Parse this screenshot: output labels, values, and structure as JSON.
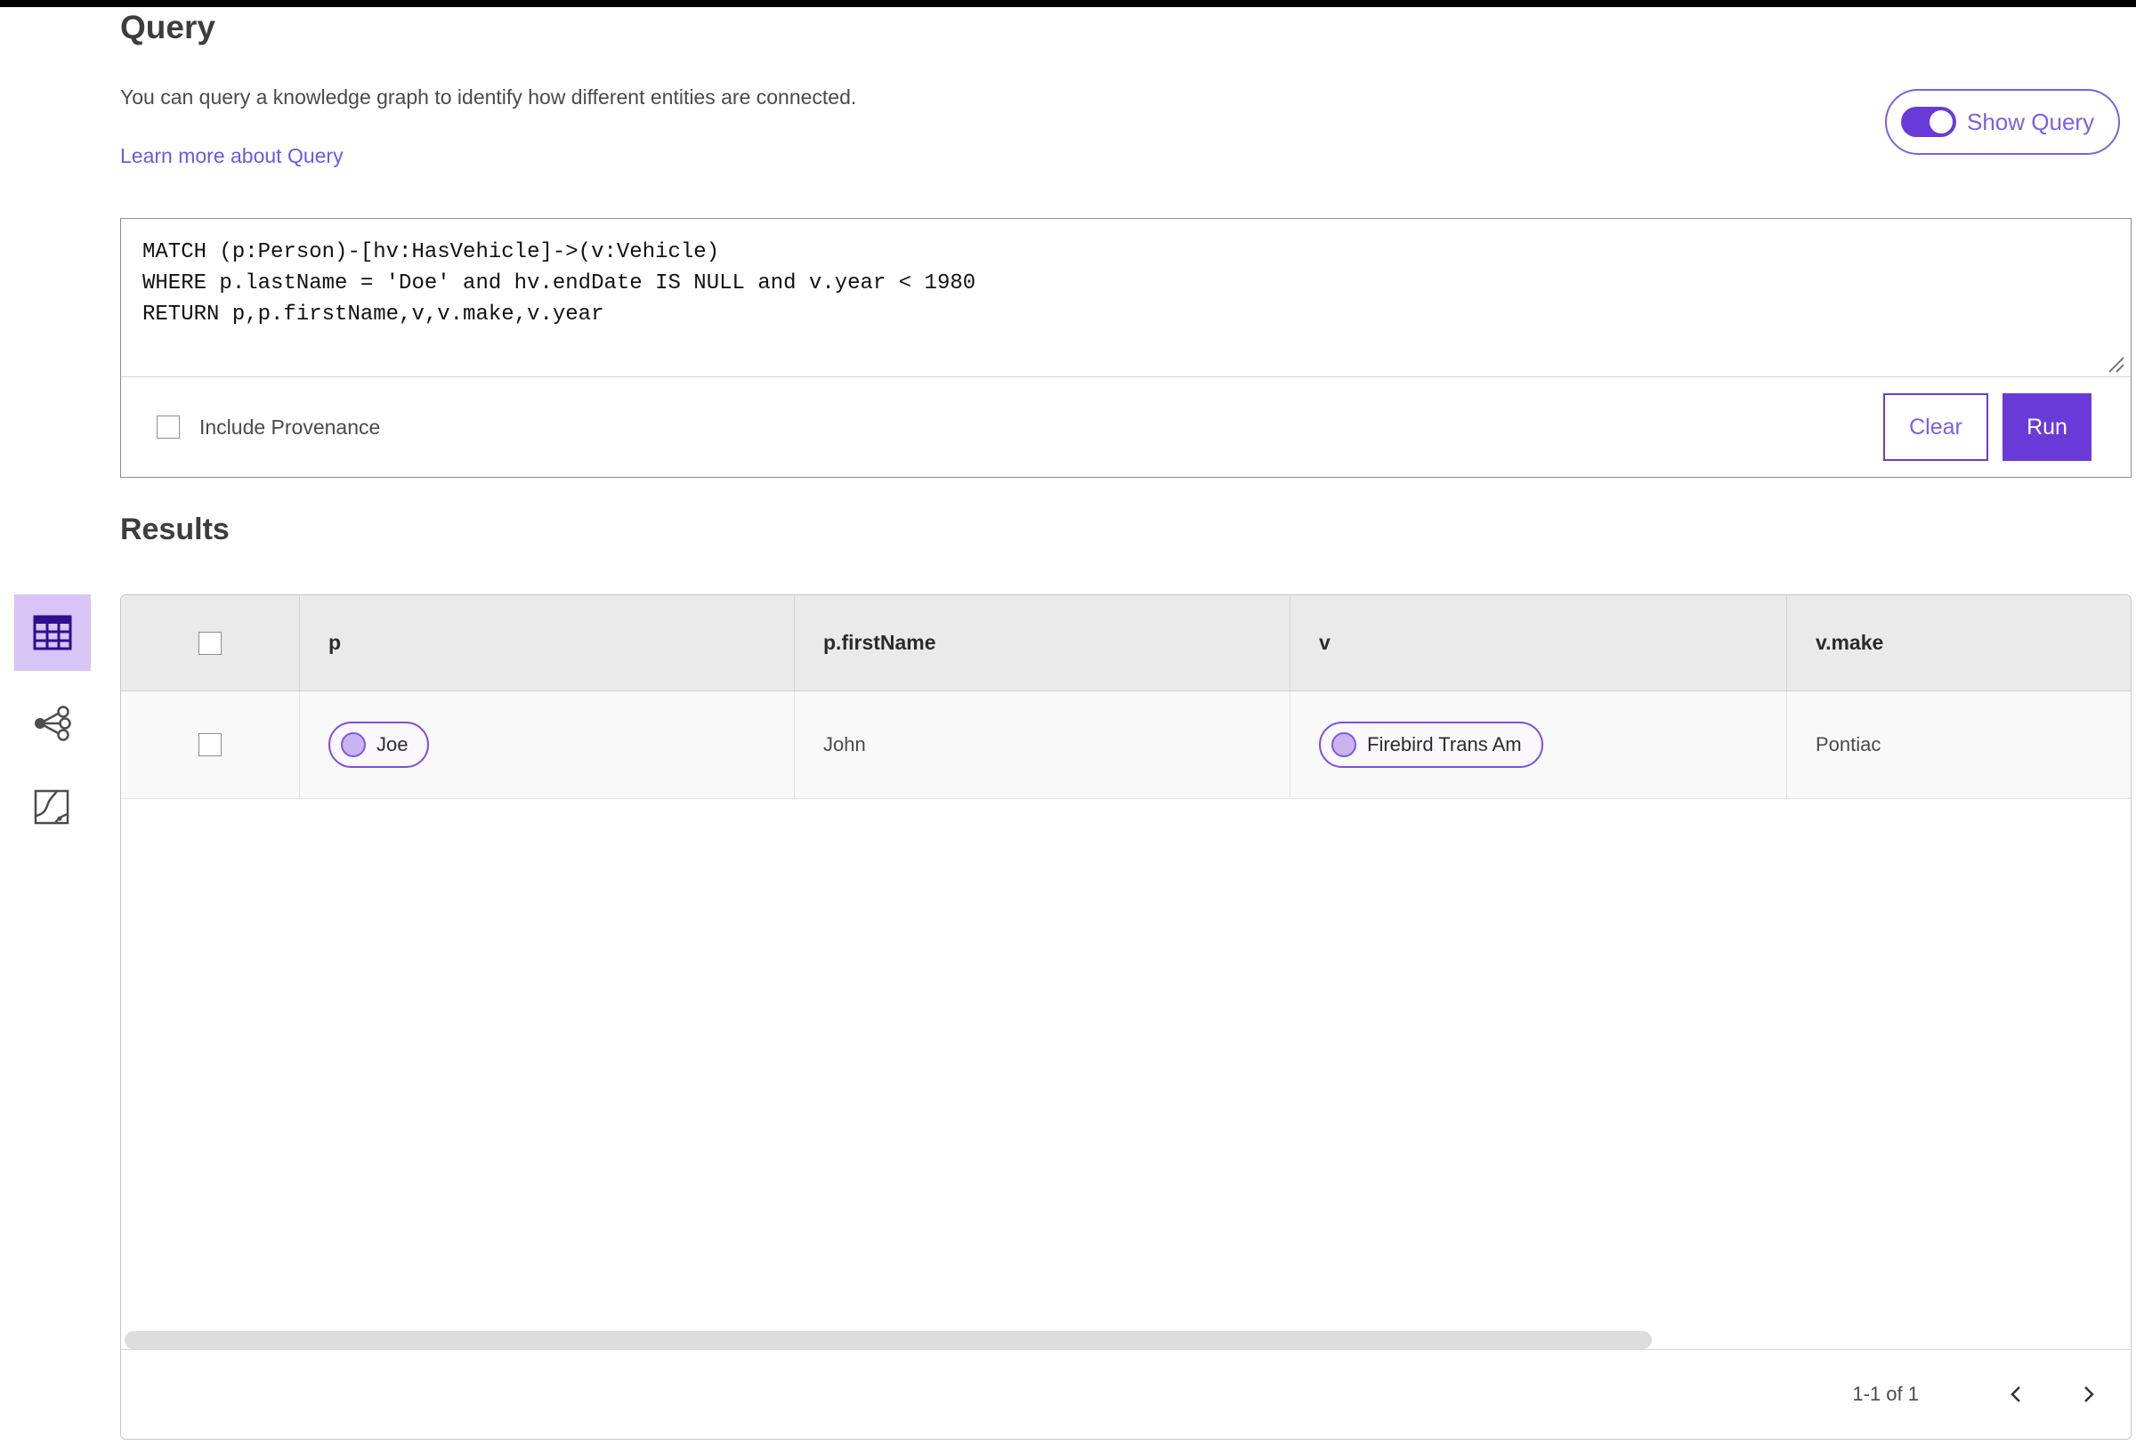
{
  "page": {
    "title": "Query",
    "description": "You can query a knowledge graph to identify how different entities are connected.",
    "learn_more_link": "Learn more about Query"
  },
  "show_query_toggle": {
    "label": "Show Query",
    "state": "on"
  },
  "query_editor": {
    "code": "MATCH (p:Person)-[hv:HasVehicle]->(v:Vehicle)\nWHERE p.lastName = 'Doe' and hv.endDate IS NULL and v.year < 1980\nRETURN p,p.firstName,v,v.make,v.year",
    "include_provenance_label": "Include Provenance",
    "include_provenance_checked": false,
    "clear_label": "Clear",
    "run_label": "Run"
  },
  "sidebar": {
    "items": [
      {
        "name": "table-view",
        "icon": "table-icon",
        "active": true
      },
      {
        "name": "link-chart-view",
        "icon": "link-chart-icon",
        "active": false
      },
      {
        "name": "map-view",
        "icon": "map-icon",
        "active": false
      }
    ]
  },
  "results": {
    "heading": "Results",
    "columns": [
      "p",
      "p.firstName",
      "v",
      "v.make"
    ],
    "rows": [
      {
        "selected": false,
        "p_label": "Joe",
        "p_firstName": "John",
        "v_label": "Firebird Trans Am",
        "v_make": "Pontiac"
      }
    ],
    "pagination": {
      "range_label": "1-1 of 1",
      "prev_icon": "chevron-left-icon",
      "next_icon": "chevron-right-icon"
    }
  },
  "colors": {
    "accent_purple": "#6a3ad9",
    "link_purple": "#6b59e4",
    "active_item_bg": "#d7c5f6",
    "pill_fill": "#faf7ff",
    "pill_dot": "#c9b4f1",
    "table_header_bg": "#eaeaea",
    "row_bg": "#f9f9f9"
  }
}
